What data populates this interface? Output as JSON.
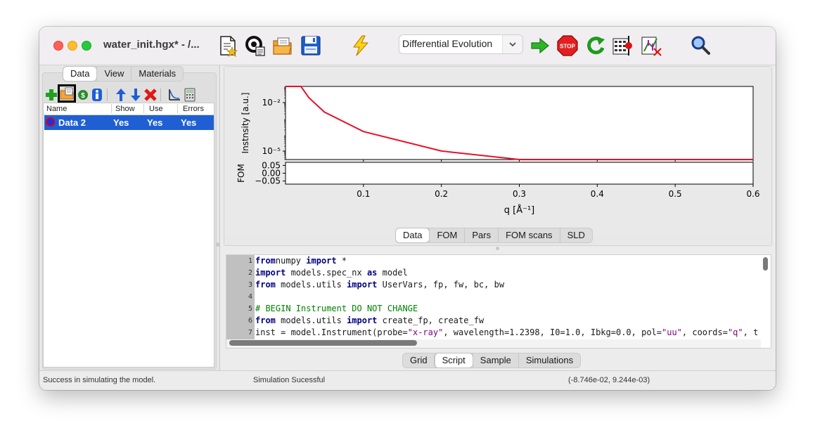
{
  "window": {
    "title": "water_init.hgx* - /...",
    "toolbar": {
      "algorithm": "Differential Evolution",
      "icons": [
        "new-file-icon",
        "open-gx-icon",
        "open-folder-icon",
        "save-icon",
        "simulate-lightning-icon",
        "algorithm-select",
        "start-fit-arrow-icon",
        "stop-icon",
        "restart-icon",
        "eval-bars-icon",
        "error-bars-icon",
        "zoom-icon"
      ]
    }
  },
  "data_panel": {
    "tabs": [
      "Data",
      "View",
      "Materials"
    ],
    "active_tab": "Data",
    "columns": [
      "Name",
      "Show",
      "Use",
      "Errors"
    ],
    "rows": [
      {
        "name": "Data 2",
        "show": "Yes",
        "use": "Yes",
        "errors": "Yes"
      }
    ]
  },
  "plot": {
    "tabs": [
      "Data",
      "FOM",
      "Pars",
      "FOM scans",
      "SLD"
    ],
    "active_tab": "Data",
    "ylabel_top": "Instnsity [a.u.]",
    "ylabel_bottom": "FOM",
    "xlabel": "q [Å⁻¹]",
    "yticks_top": [
      "10⁻²",
      "10⁻⁵"
    ],
    "yticks_bottom": [
      "0.05",
      "0.00",
      "−0.05"
    ],
    "xticks": [
      "0.1",
      "0.2",
      "0.3",
      "0.4",
      "0.5",
      "0.6"
    ],
    "line_color": "#e8102a"
  },
  "chart_data": {
    "type": "line",
    "title": "",
    "xlabel": "q [Å⁻¹]",
    "ylabel": "Instnsity [a.u.]",
    "yscale": "log",
    "xlim": [
      0.0,
      0.6
    ],
    "ylim": [
      3e-06,
      0.1
    ],
    "series": [
      {
        "x": [
          0.0,
          0.02,
          0.021,
          0.03,
          0.05,
          0.1,
          0.2,
          0.3,
          0.4,
          0.5,
          0.6
        ],
        "values": [
          0.1,
          0.1,
          0.083,
          0.0199,
          0.00258,
          0.000162,
          1.01e-05,
          2e-06,
          6.3e-07,
          2.6e-07,
          1.25e-07
        ]
      }
    ],
    "fom_panel": {
      "ylim": [
        -0.07,
        0.07
      ],
      "yticks": [
        -0.05,
        0.0,
        0.05
      ]
    }
  },
  "editor": {
    "tabs": [
      "Grid",
      "Script",
      "Sample",
      "Simulations"
    ],
    "active_tab": "Script",
    "lines": [
      {
        "n": "1",
        "parts": [
          [
            "kw",
            "from"
          ],
          [
            "",
            "numpy "
          ],
          [
            "kw",
            "import"
          ],
          [
            "",
            " *"
          ]
        ]
      },
      {
        "n": "2",
        "parts": [
          [
            "kw",
            "import"
          ],
          [
            "",
            " models.spec_nx "
          ],
          [
            "kw",
            "as"
          ],
          [
            "",
            " model"
          ]
        ]
      },
      {
        "n": "3",
        "parts": [
          [
            "kw",
            "from"
          ],
          [
            "",
            " models.utils "
          ],
          [
            "kw",
            "import"
          ],
          [
            "",
            " UserVars, fp, fw, bc, bw"
          ]
        ]
      },
      {
        "n": "4",
        "parts": []
      },
      {
        "n": "5",
        "parts": [
          [
            "cm",
            "# BEGIN Instrument DO NOT CHANGE"
          ]
        ]
      },
      {
        "n": "6",
        "parts": [
          [
            "kw",
            "from"
          ],
          [
            "",
            " models.utils "
          ],
          [
            "kw",
            "import"
          ],
          [
            "",
            " create_fp, create_fw"
          ]
        ]
      },
      {
        "n": "7",
        "parts": [
          [
            "",
            "inst = model.Instrument(probe="
          ],
          [
            "st",
            "\"x-ray\""
          ],
          [
            "",
            ", wavelength=1.2398, I0=1.0, Ibkg=0.0, pol="
          ],
          [
            "st",
            "\"uu\""
          ],
          [
            "",
            ", coords="
          ],
          [
            "st",
            "\"q\""
          ],
          [
            "",
            ", t"
          ]
        ]
      }
    ]
  },
  "status": {
    "left": "Success in simulating the model.",
    "middle": "Simulation Sucessful",
    "right": "(-8.746e-02, 9.244e-03)"
  }
}
